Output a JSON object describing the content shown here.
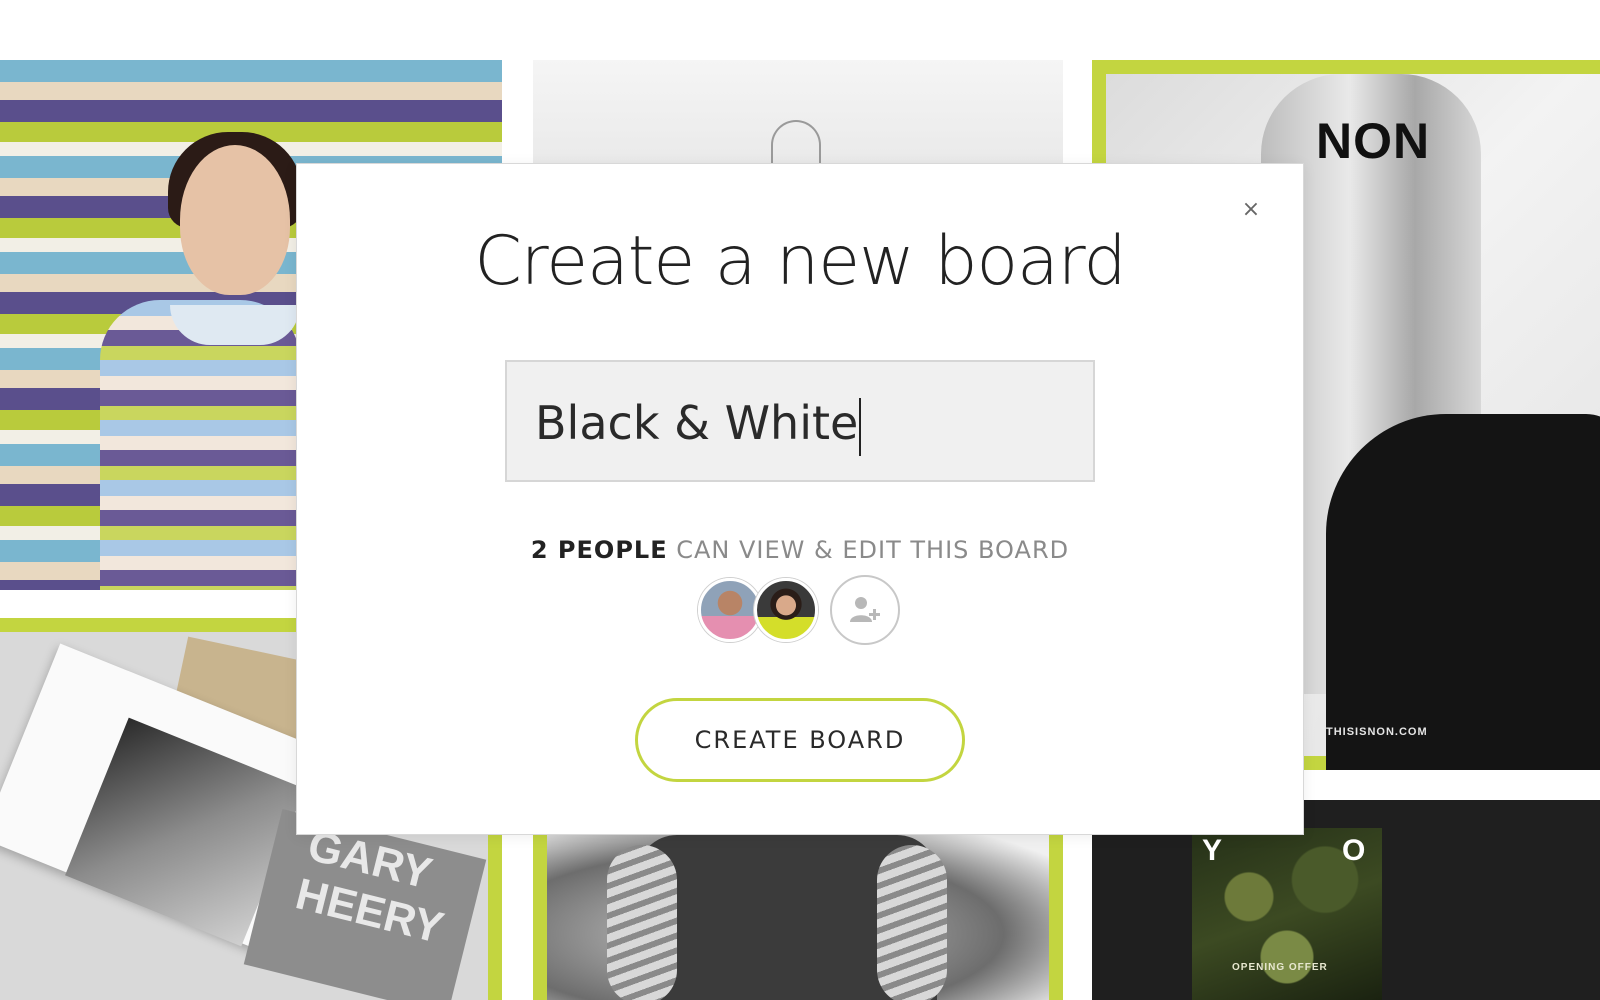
{
  "background": {
    "tile_non": {
      "brand": "NON",
      "url": "THISISNON.COM"
    },
    "tile_books": {
      "card_text": "GARY HEERY"
    },
    "tile_yo": {
      "letter_left": "Y",
      "letter_right": "O",
      "offer": "OPENING OFFER"
    }
  },
  "modal": {
    "title": "Create a new board",
    "close_symbol": "×",
    "name_input": {
      "value": "Black & White"
    },
    "share": {
      "count_label": "2 PEOPLE",
      "text": "CAN VIEW & EDIT THIS BOARD"
    },
    "people": [
      {
        "name": "collaborator-1"
      },
      {
        "name": "collaborator-2"
      }
    ],
    "create_button_label": "CREATE BOARD"
  },
  "colors": {
    "accent": "#c3d540",
    "title": "#222222",
    "muted": "#8a8a8a"
  },
  "icons": {
    "close": "close-icon",
    "add_person": "add-person-icon"
  }
}
